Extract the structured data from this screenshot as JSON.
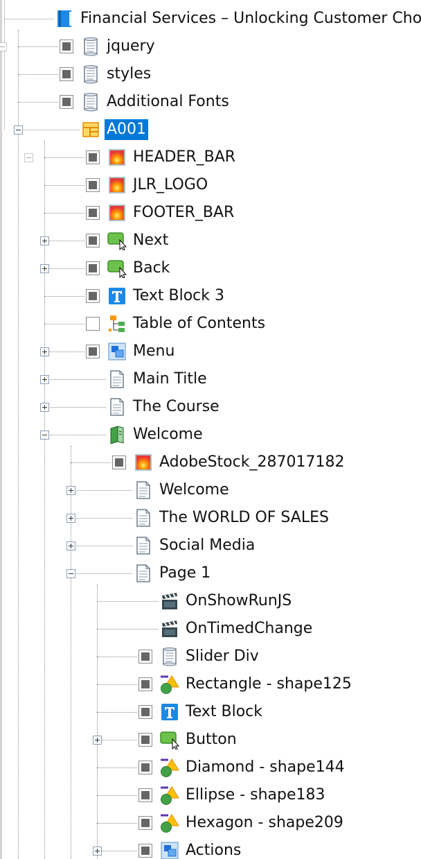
{
  "tree": {
    "nodes": [
      {
        "label": "Financial Services – Unlocking Customer Choi",
        "depth": 0,
        "icon": "book-icon",
        "checkbox": null,
        "expander": null
      },
      {
        "label": "jquery",
        "depth": 1,
        "icon": "script-file-icon",
        "checkbox": "on",
        "expander": null
      },
      {
        "label": "styles",
        "depth": 1,
        "icon": "script-file-icon",
        "checkbox": "on",
        "expander": null
      },
      {
        "label": "Additional Fonts",
        "depth": 1,
        "icon": "script-file-icon",
        "checkbox": "on",
        "expander": null
      },
      {
        "label": "A001",
        "depth": 1,
        "icon": "layout-icon",
        "checkbox": null,
        "expander": "minus",
        "selected": true
      },
      {
        "label": "HEADER_BAR",
        "depth": 2,
        "icon": "image-icon",
        "checkbox": "on",
        "expander": null
      },
      {
        "label": "JLR_LOGO",
        "depth": 2,
        "icon": "image-icon",
        "checkbox": "on",
        "expander": null
      },
      {
        "label": "FOOTER_BAR",
        "depth": 2,
        "icon": "image-icon",
        "checkbox": "on",
        "expander": null
      },
      {
        "label": "Next",
        "depth": 2,
        "icon": "button-icon",
        "checkbox": "on",
        "expander": "plus"
      },
      {
        "label": "Back",
        "depth": 2,
        "icon": "button-icon",
        "checkbox": "on",
        "expander": "plus"
      },
      {
        "label": "Text Block 3",
        "depth": 2,
        "icon": "text-block-icon",
        "checkbox": "on",
        "expander": null
      },
      {
        "label": "Table of Contents",
        "depth": 2,
        "icon": "toc-icon",
        "checkbox": "off",
        "expander": null
      },
      {
        "label": "Menu",
        "depth": 2,
        "icon": "group-icon",
        "checkbox": "on",
        "expander": "plus"
      },
      {
        "label": "Main Title",
        "depth": 2,
        "icon": "page-icon",
        "checkbox": null,
        "expander": "plus"
      },
      {
        "label": "The Course",
        "depth": 2,
        "icon": "page-icon",
        "checkbox": null,
        "expander": "plus"
      },
      {
        "label": "Welcome",
        "depth": 2,
        "icon": "chapter-icon",
        "checkbox": null,
        "expander": "minus"
      },
      {
        "label": "AdobeStock_287017182",
        "depth": 3,
        "icon": "image-icon",
        "checkbox": "on",
        "expander": null
      },
      {
        "label": "Welcome",
        "depth": 3,
        "icon": "page-icon",
        "checkbox": null,
        "expander": "plus"
      },
      {
        "label": "The WORLD OF SALES",
        "depth": 3,
        "icon": "page-icon",
        "checkbox": null,
        "expander": "plus"
      },
      {
        "label": "Social Media",
        "depth": 3,
        "icon": "page-icon",
        "checkbox": null,
        "expander": "plus"
      },
      {
        "label": "Page 1",
        "depth": 3,
        "icon": "page-icon",
        "checkbox": null,
        "expander": "minus"
      },
      {
        "label": "OnShowRunJS",
        "depth": 4,
        "icon": "action-clapper-icon",
        "checkbox": null,
        "expander": null
      },
      {
        "label": "OnTimedChange",
        "depth": 4,
        "icon": "action-clapper-icon",
        "checkbox": null,
        "expander": null
      },
      {
        "label": "Slider Div",
        "depth": 4,
        "icon": "script-file-icon",
        "checkbox": "on",
        "expander": null
      },
      {
        "label": "Rectangle - shape125",
        "depth": 4,
        "icon": "shape-icon",
        "checkbox": "on",
        "expander": null
      },
      {
        "label": "Text Block",
        "depth": 4,
        "icon": "text-block-icon",
        "checkbox": "on",
        "expander": null
      },
      {
        "label": "Button",
        "depth": 4,
        "icon": "button-icon",
        "checkbox": "on",
        "expander": "plus"
      },
      {
        "label": "Diamond - shape144",
        "depth": 4,
        "icon": "shape-icon",
        "checkbox": "on",
        "expander": null
      },
      {
        "label": "Ellipse - shape183",
        "depth": 4,
        "icon": "shape-icon",
        "checkbox": "on",
        "expander": null
      },
      {
        "label": "Hexagon - shape209",
        "depth": 4,
        "icon": "shape-icon",
        "checkbox": "on",
        "expander": null
      },
      {
        "label": "Actions",
        "depth": 4,
        "icon": "group-icon",
        "checkbox": "on",
        "expander": "plus"
      }
    ]
  },
  "colors": {
    "selection": "#0078d7",
    "tree_lines": "#8c8c8c"
  }
}
